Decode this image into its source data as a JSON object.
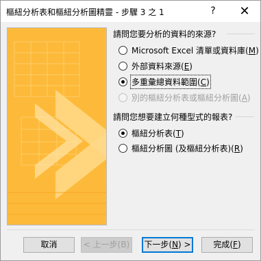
{
  "window": {
    "title": "樞紐分析表和樞紐分析圖精靈 - 步驟 3 之 1",
    "help_glyph": "?",
    "close_glyph": "✕"
  },
  "source_group": {
    "label": "請問您要分析的資料的來源?",
    "options": [
      {
        "pre": "Microsoft Excel 清單或資料庫(",
        "mn": "M",
        "post": ")",
        "selected": false,
        "disabled": false
      },
      {
        "pre": "外部資料來源(",
        "mn": "E",
        "post": ")",
        "selected": false,
        "disabled": false
      },
      {
        "pre": "多重彙總資料範圍(",
        "mn": "C",
        "post": ")",
        "selected": true,
        "disabled": false
      },
      {
        "pre": "別的樞紐分析表或樞紐分析圖(",
        "mn": "A",
        "post": ")",
        "selected": false,
        "disabled": true
      }
    ]
  },
  "report_group": {
    "label": "請問您想要建立何種型式的報表?",
    "options": [
      {
        "pre": "樞紐分析表(",
        "mn": "T",
        "post": ")",
        "selected": true,
        "disabled": false
      },
      {
        "pre": "樞紐分析圖 (及樞紐分析表)(",
        "mn": "R",
        "post": ")",
        "selected": false,
        "disabled": false
      }
    ]
  },
  "buttons": {
    "cancel": "取消",
    "back": "< 上一步(B)",
    "next_pre": "下一步(",
    "next_mn": "N",
    "next_post": ") >",
    "finish_pre": "完成(",
    "finish_mn": "F",
    "finish_post": ")"
  },
  "colors": {
    "art_base": "#fdba3a",
    "art_light": "#ffd98a",
    "art_stripe": "#f7a824"
  }
}
